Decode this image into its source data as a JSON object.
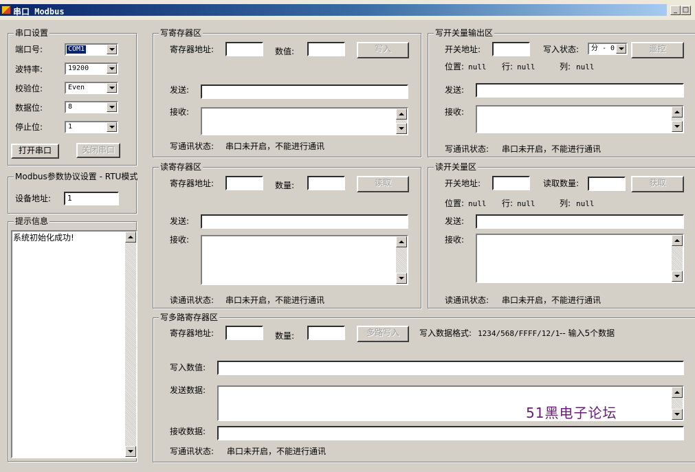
{
  "window": {
    "title": "串口 Modbus",
    "min": "_",
    "max": "□",
    "close": "×"
  },
  "serial": {
    "caption": "串口设置",
    "port_label": "端口号:",
    "port_value": "COM1",
    "baud_label": "波特率:",
    "baud_value": "19200",
    "parity_label": "校验位:",
    "parity_value": "Even",
    "data_label": "数据位:",
    "data_value": "8",
    "stop_label": "停止位:",
    "stop_value": "1",
    "open_button": "打开串口",
    "close_button": "关闭串口"
  },
  "modbus": {
    "caption": "Modbus参数协议设置 - RTU模式",
    "device_label": "设备地址:",
    "device_value": "1"
  },
  "info": {
    "caption": "提示信息",
    "text": "系统初始化成功!"
  },
  "write_reg": {
    "caption": "写寄存器区",
    "addr_label": "寄存器地址:",
    "value_label": "数值:",
    "button": "写入",
    "send_label": "发送:",
    "recv_label": "接收:",
    "status_label": "写通讯状态:",
    "status_value": "串口未开启，不能进行通讯"
  },
  "write_coil": {
    "caption": "写开关量输出区",
    "addr_label": "开关地址:",
    "state_label": "写入状态:",
    "state_value": "分 - 0",
    "button": "遥控",
    "pos_label": "位置:",
    "pos_value": "null",
    "row_label": "行:",
    "row_value": "null",
    "col_label": "列:",
    "col_value": "null",
    "send_label": "发送:",
    "recv_label": "接收:",
    "status_label": "写通讯状态:",
    "status_value": "串口未开启，不能进行通讯"
  },
  "read_reg": {
    "caption": "读寄存器区",
    "addr_label": "寄存器地址:",
    "count_label": "数量:",
    "button": "读取",
    "send_label": "发送:",
    "recv_label": "接收:",
    "status_label": "读通讯状态:",
    "status_value": "串口未开启，不能进行通讯"
  },
  "read_coil": {
    "caption": "读开关量区",
    "addr_label": "开关地址:",
    "count_label": "读取数量:",
    "button": "获取",
    "pos_label": "位置:",
    "pos_value": "null",
    "row_label": "行:",
    "row_value": "null",
    "col_label": "列:",
    "col_value": "null",
    "send_label": "发送:",
    "recv_label": "接收:",
    "status_label": "读通讯状态:",
    "status_value": "串口未开启，不能进行通讯"
  },
  "multi_reg": {
    "caption": "写多路寄存器区",
    "addr_label": "寄存器地址:",
    "count_label": "数量:",
    "button": "多路写入",
    "format_label": "写入数据格式:",
    "format_value": "1234/568/FFFF/12/1",
    "format_hint": "-- 输入5个数据",
    "write_label": "写入数值:",
    "send_label": "发送数据:",
    "recv_label": "接收数据:",
    "status_label": "写通讯状态:",
    "status_value": "串口未开启，不能进行通讯"
  },
  "watermark": "51黑电子论坛"
}
